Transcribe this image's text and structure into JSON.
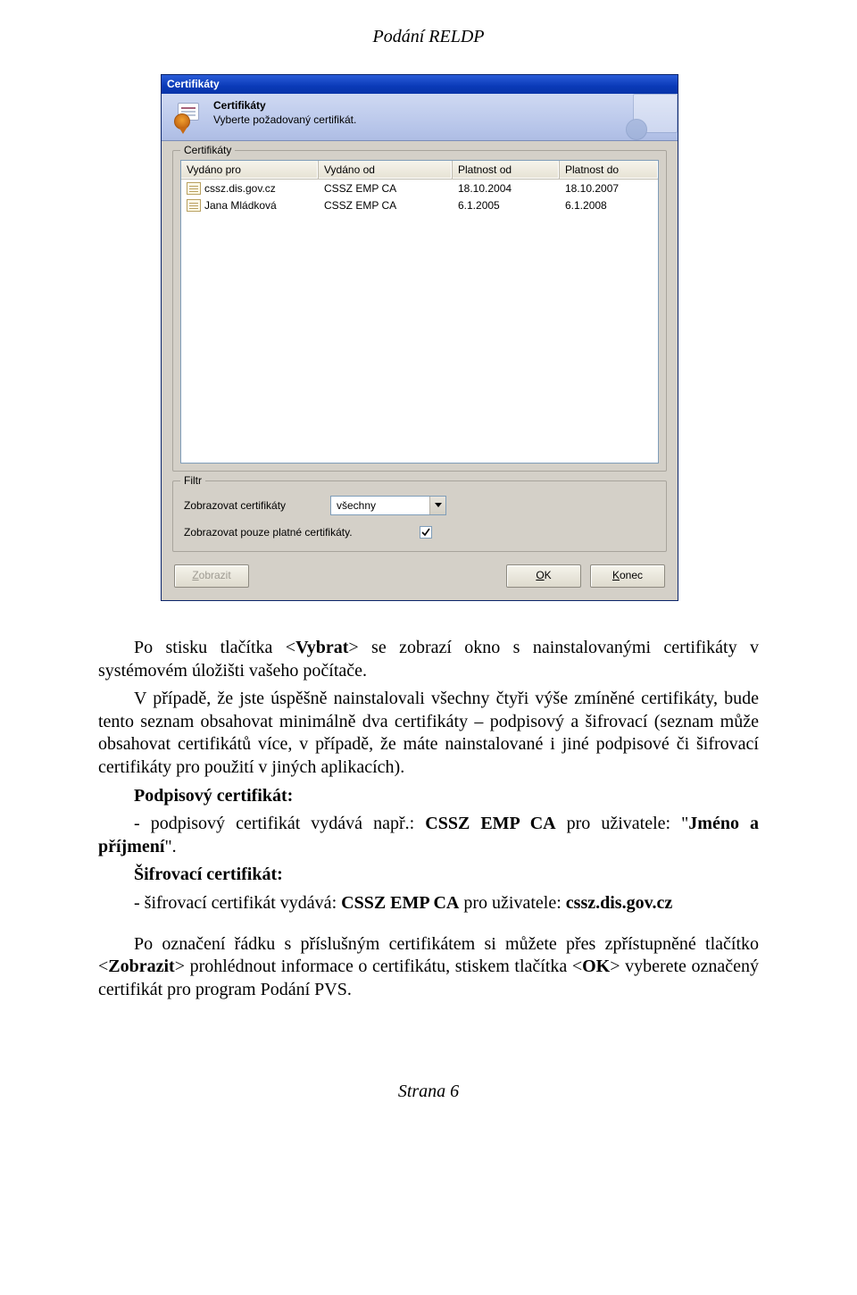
{
  "header": "Podání RELDP",
  "footer": "Strana 6",
  "dialog": {
    "title": "Certifikáty",
    "banner_title": "Certifikáty",
    "banner_sub": "Vyberte požadovaný certifikát.",
    "group_certs_label": "Certifikáty",
    "columns": {
      "c1": "Vydáno pro",
      "c2": "Vydáno od",
      "c3": "Platnost od",
      "c4": "Platnost do"
    },
    "rows": [
      {
        "c1": "cssz.dis.gov.cz",
        "c2": "CSSZ EMP CA",
        "c3": "18.10.2004",
        "c4": "18.10.2007"
      },
      {
        "c1": "Jana Mládková",
        "c2": "CSSZ EMP CA",
        "c3": "6.1.2005",
        "c4": "6.1.2008"
      }
    ],
    "group_filter_label": "Filtr",
    "filter_show_label": "Zobrazovat certifikáty",
    "filter_value": "všechny",
    "filter_valid_label": "Zobrazovat pouze platné certifikáty.",
    "filter_valid_checked": true,
    "btn_show": "Zobrazit",
    "btn_ok": "OK",
    "btn_close": "Konec"
  },
  "text": {
    "p1a": "Po stisku tlačítka <",
    "p1b": "Vybrat",
    "p1c": "> se zobrazí okno s nainstalovanými certifikáty v systémovém úložišti vašeho počítače.",
    "p2": "V případě, že jste úspěšně nainstalovali všechny čtyři výše zmíněné certifikáty, bude tento seznam obsahovat minimálně dva certifikáty – podpisový a šifrovací (seznam může obsahovat certifikátů více, v případě, že máte nainstalované i jiné podpisové či šifrovací certifikáty pro použití v jiných aplikacích).",
    "sign_heading": "Podpisový certifikát:",
    "sign_line_a": "- podpisový certifikát vydává např.: ",
    "sign_line_b": "CSSZ EMP CA",
    "sign_line_c": " pro uživatele: \"",
    "sign_line_d": "Jméno a příjmení",
    "sign_line_e": "\".",
    "enc_heading": "Šifrovací certifikát:",
    "enc_line_a": "- šifrovací certifikát vydává: ",
    "enc_line_b": "CSSZ EMP CA",
    "enc_line_c": " pro uživatele: ",
    "enc_line_d": "cssz.dis.gov.cz",
    "p3a": "Po označení řádku s příslušným certifikátem si můžete přes zpřístupněné tlačítko <",
    "p3b": "Zobrazit",
    "p3c": "> prohlédnout informace o certifikátu, stiskem tlačítka <",
    "p3d": "OK",
    "p3e": "> vyberete označený certifikát pro program Podání PVS."
  }
}
